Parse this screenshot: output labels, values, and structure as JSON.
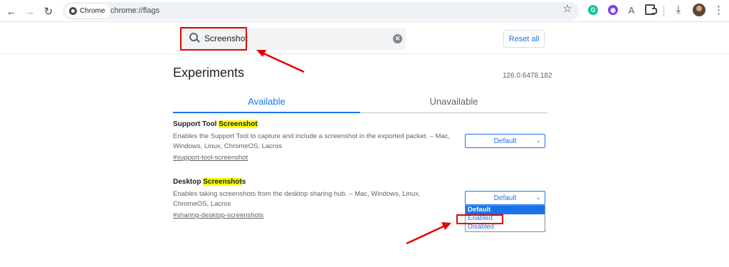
{
  "browser": {
    "chip_label": "Chrome",
    "url": "chrome://flags",
    "icons": {
      "back": "back-arrow-icon",
      "forward": "forward-arrow-icon",
      "reload": "reload-icon",
      "bookmark": "star-icon",
      "extensions": "puzzle-icon",
      "downloads": "download-icon",
      "menu": "more-vertical-icon"
    }
  },
  "header": {
    "search_value": "Screenshot",
    "reset_label": "Reset all"
  },
  "main": {
    "title": "Experiments",
    "version": "126.0.6478.182",
    "tabs": [
      {
        "label": "Available",
        "active": true
      },
      {
        "label": "Unavailable",
        "active": false
      }
    ],
    "experiments": [
      {
        "title_prefix": "Support Tool ",
        "title_match": "Screenshot",
        "title_suffix": "",
        "description_1": "Enables the Support Tool to capture and include a screenshot in the exported packet. – Mac,",
        "description_2": "Windows, Linux, ChromeOS, Lacros",
        "link": "#support-tool-screenshot",
        "select_value": "Default"
      },
      {
        "title_prefix": "Desktop ",
        "title_match": "Screenshot",
        "title_suffix": "s",
        "description_1": "Enables taking screenshots from the desktop sharing hub. – Mac, Windows, Linux,",
        "description_2": "ChromeOS, Lacros",
        "link": "#sharing-desktop-screenshots",
        "select_value": "Default",
        "options": [
          "Default",
          "Enabled",
          "Disabled"
        ]
      }
    ]
  },
  "colors": {
    "accent": "#1a73e8",
    "highlight": "#ffff00",
    "annotation": "#e60000"
  }
}
